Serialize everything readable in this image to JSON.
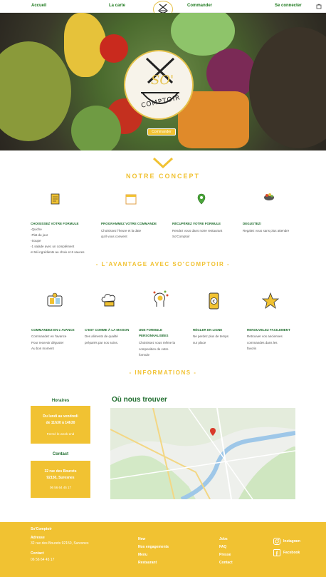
{
  "nav": {
    "items": [
      "Accueil",
      "La carte",
      "Commander",
      "Se connecter"
    ],
    "cart_icon": "cart-icon",
    "logo_icon": "bowl-fork-knife-icon"
  },
  "hero": {
    "logo_text_1": "SO'",
    "logo_text_2": "COMPTOIR",
    "button_label": "Commander"
  },
  "concept": {
    "title": "NOTRE CONCEPT",
    "items": [
      {
        "icon": "menu-card-icon",
        "title": "CHOISISSEZ VOTRE FORMULE",
        "text": [
          "-Quiche",
          "-Plat du jour",
          "-Soupe",
          "-1 salade avec un complément",
          "et 5é ingrédients au choix et 6 sauces"
        ]
      },
      {
        "icon": "calendar-icon",
        "title": "PROGRAMMEZ VOTRE COMMANDE",
        "text": [
          "Choisissez l'heure et la date",
          "qu'il vous convient"
        ]
      },
      {
        "icon": "map-pin-icon",
        "title": "RÉCUPÉREZ VOTRE FORMULE",
        "text": [
          "Rendez vous dans notre restaurant",
          "So'Comptoir"
        ]
      },
      {
        "icon": "food-bowl-icon",
        "title": "DEGUSTEZ!",
        "text": [
          "Regalez vous sans plus attendre"
        ]
      }
    ]
  },
  "advantage": {
    "title": "- L'AVANTAGE AVEC SO'COMPTOIR -",
    "items": [
      {
        "icon": "phone-order-icon",
        "title": "COMMANDEZ EN L'AVANCE",
        "text": [
          "Commandez en l'avance",
          "Pour recevoir déguster",
          "Au bon moment"
        ]
      },
      {
        "icon": "chef-hat-icon",
        "title": "C'EST COMME À LA MAISON",
        "text": [
          "Des aliments de qualité",
          "préparés par nos soins."
        ]
      },
      {
        "icon": "idea-head-icon",
        "title": "UNE FORMULE PERSONNALISÉES",
        "text": [
          "Choisissez vous même la",
          "composition de votre",
          "formule"
        ]
      },
      {
        "icon": "euro-phone-icon",
        "title": "RÉGLER EN LIGNE",
        "text": [
          "Ne perdez plus de temps",
          "sur place"
        ]
      },
      {
        "icon": "star-icon",
        "title": "RENOUVELEZ FACILEMENT",
        "text": [
          "Retrouver vos anciennes",
          "commandes dans les",
          "favoris"
        ]
      }
    ]
  },
  "informations": {
    "title": "- INFORMATIONS -",
    "hours_heading": "Horaires",
    "hours_line1": "Du lundi au vendredi",
    "hours_line2": "de 11h30 à 14h30",
    "hours_closed": "Fermé le week-end",
    "contact_heading": "Contact",
    "address_line1": "32 rue des Bourets",
    "address_line2": "92150, Suresnes",
    "phone": "06 56 64 45 17",
    "map_title": "Où nous trouver"
  },
  "footer": {
    "brand": "So'Comptoir",
    "address_label": "Adresse",
    "address_value": "32 rue des Bourets 92150, Suresnes",
    "contact_label": "Contact",
    "contact_value": "06 56 64 45 17",
    "col2": [
      "New",
      "Nos engagements",
      "Menu",
      "Restaurant"
    ],
    "col3": [
      "Jobs",
      "FAQ",
      "Presse",
      "Contact"
    ],
    "social": [
      {
        "icon": "instagram-icon",
        "label": "Instagram"
      },
      {
        "icon": "facebook-icon",
        "label": "Facebook"
      }
    ]
  },
  "colors": {
    "accent": "#f1c232",
    "green": "#1f6d2e"
  }
}
